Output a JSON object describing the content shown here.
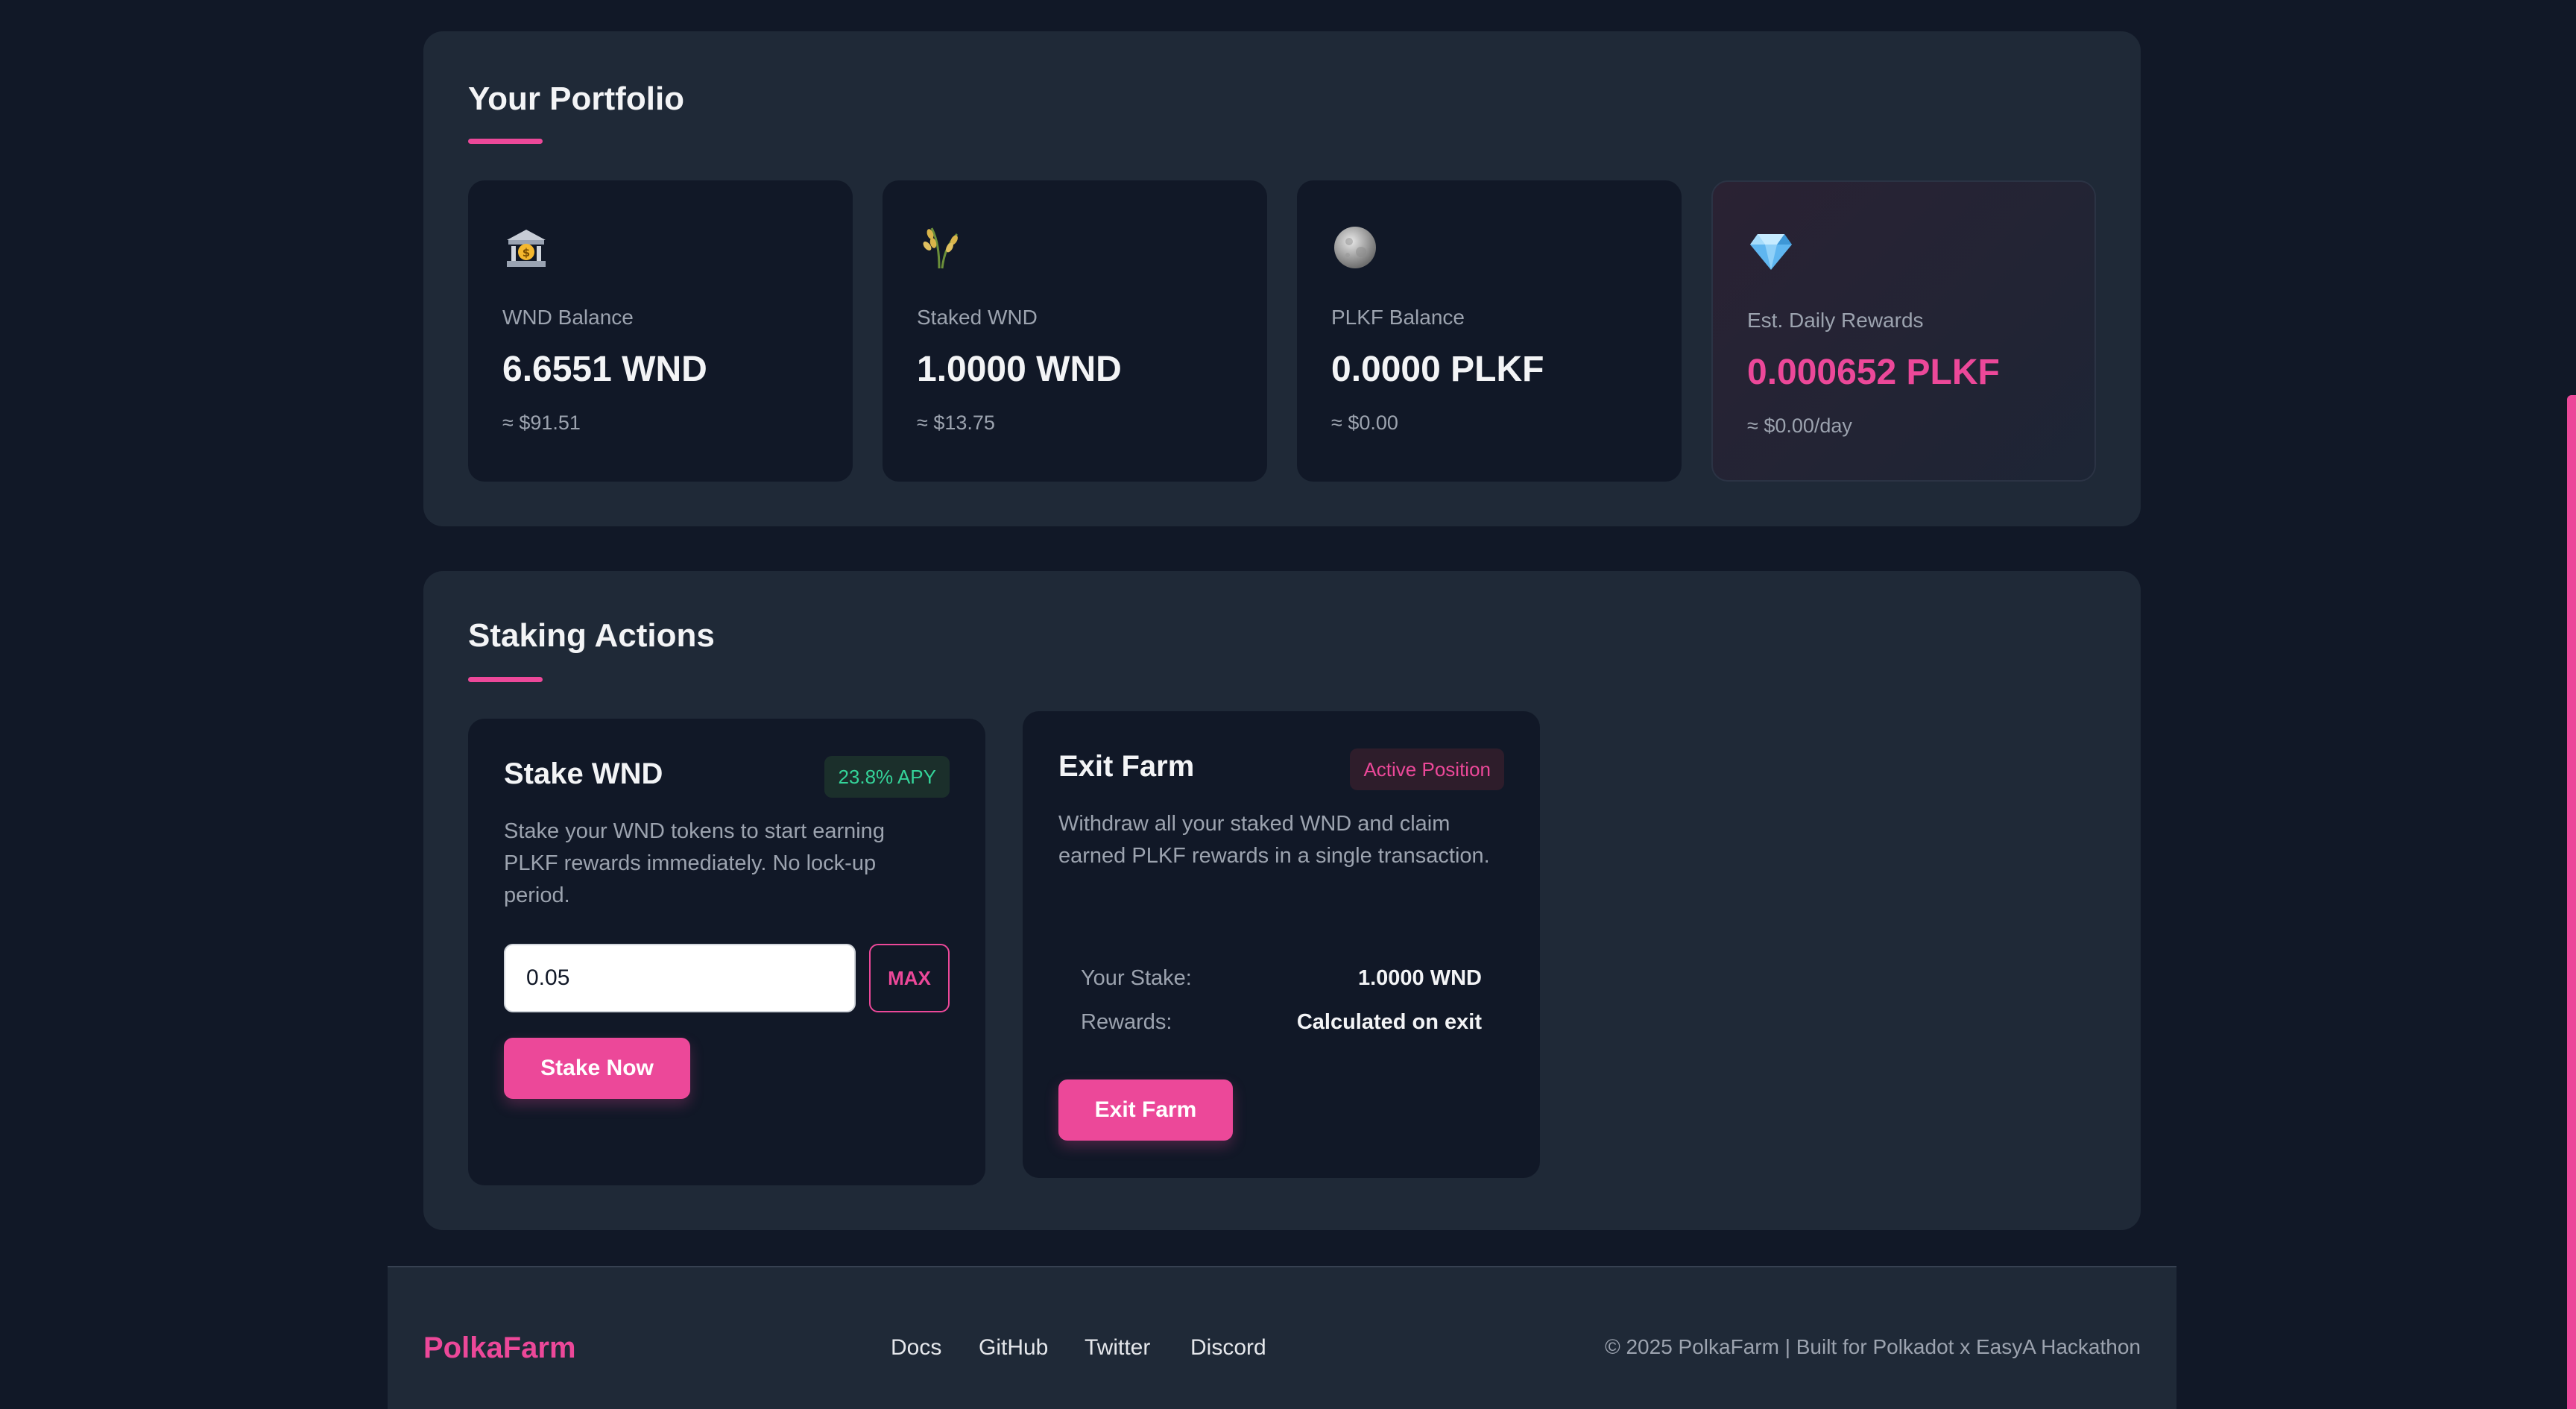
{
  "portfolio": {
    "title": "Your Portfolio",
    "cards": [
      {
        "icon": "bank-icon",
        "label": "WND Balance",
        "value": "6.6551 WND",
        "sub": "≈ $91.51"
      },
      {
        "icon": "rice-icon",
        "label": "Staked WND",
        "value": "1.0000 WND",
        "sub": "≈ $13.75"
      },
      {
        "icon": "moon-icon",
        "label": "PLKF Balance",
        "value": "0.0000 PLKF",
        "sub": "≈ $0.00"
      },
      {
        "icon": "gem-icon",
        "label": "Est. Daily Rewards",
        "value": "0.000652 PLKF",
        "sub": "≈ $0.00/day"
      }
    ]
  },
  "staking": {
    "title": "Staking Actions",
    "stake": {
      "title": "Stake WND",
      "badge": "23.8% APY",
      "description": "Stake your WND tokens to start earning PLKF rewards immediately. No lock-up period.",
      "input_value": "0.05",
      "max_label": "MAX",
      "button_label": "Stake Now"
    },
    "exit": {
      "title": "Exit Farm",
      "badge": "Active Position",
      "description": "Withdraw all your staked WND and claim earned PLKF rewards in a single transaction.",
      "rows": [
        {
          "label": "Your Stake:",
          "value": "1.0000 WND"
        },
        {
          "label": "Rewards:",
          "value": "Calculated on exit"
        }
      ],
      "button_label": "Exit Farm"
    }
  },
  "footer": {
    "logo": "PolkaFarm",
    "links": [
      "Docs",
      "GitHub",
      "Twitter",
      "Discord"
    ],
    "copyright": "© 2025 PolkaFarm | Built for Polkadot x EasyA Hackathon"
  },
  "colors": {
    "background": "#111827",
    "panel": "#1f2937",
    "accent": "#ec4899",
    "success": "#34d399",
    "muted": "#9ca3af"
  }
}
